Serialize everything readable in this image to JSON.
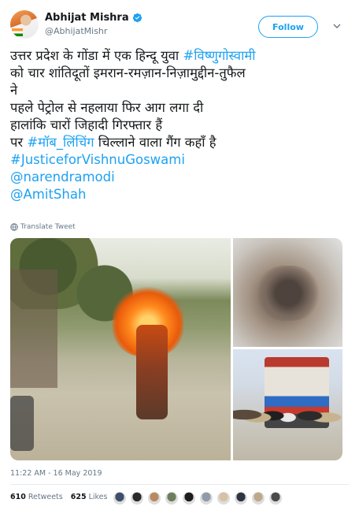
{
  "tweet": {
    "display_name": "Abhijat Mishra",
    "handle": "@AbhijatMishr",
    "follow_label": "Follow",
    "lines": [
      {
        "prefix": "उत्तर प्रदेश के गोंडा में एक हिन्दू युवा ",
        "hashtag": "#विष्णुगोस्वामी"
      },
      {
        "prefix": "को चार शांतिदूतों इमरान-रमज़ान-निज़ामुद्दीन-तुफैल",
        "hashtag": ""
      },
      {
        "prefix": "ने",
        "hashtag": ""
      },
      {
        "prefix": "पहले पेट्रोल से नहलाया फिर आग लगा दी",
        "hashtag": ""
      },
      {
        "prefix": "हालांकि चारों जिहादी गिरफ्तार हैं",
        "hashtag": ""
      },
      {
        "prefix": "पर ",
        "hashtag": "#मॉब_लिंचिंग",
        "suffix": " चिल्लाने वाला गैंग कहाँ है"
      }
    ],
    "link_lines": [
      "#JusticeforVishnuGoswami",
      "@narendramodi",
      "@AmitShah"
    ],
    "translate_label": "Translate Tweet",
    "timestamp": "11:22 AM - 16 May 2019",
    "retweets_count": "610",
    "retweets_label": "Retweets",
    "likes_count": "625",
    "likes_label": "Likes"
  },
  "colors": {
    "accent": "#1da1f2",
    "secondary_text": "#657786"
  },
  "icons": {
    "verified": "verified-badge-icon",
    "caret": "chevron-down-icon",
    "translate": "globe-icon"
  },
  "likers": [
    "#3d4f6b",
    "#2a2a2a",
    "#b98a62",
    "#6d7f5a",
    "#1c1c1c",
    "#8f9ba8",
    "#d8c2a5",
    "#2e3440",
    "#c0a88a",
    "#4b4b4b"
  ]
}
